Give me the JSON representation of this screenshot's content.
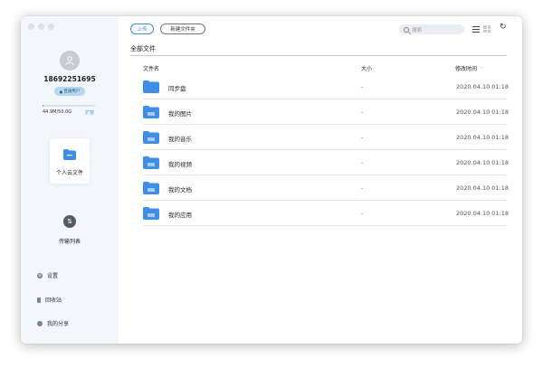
{
  "sidebar": {
    "username": "18692251695",
    "badge": "普通用户",
    "storage_text": "44.9M/50.0G",
    "storage_used_fraction": 0.02,
    "expand_label": "扩容",
    "nav": {
      "personal_cloud": "个人云文件",
      "transfer": "传输列表"
    },
    "links": {
      "settings": "设置",
      "trash": "回收站",
      "share": "我的分享"
    }
  },
  "toolbar": {
    "upload": "上传",
    "new_folder": "新建文件夹",
    "search_placeholder": "搜索",
    "refresh_glyph": "↻"
  },
  "breadcrumb": "全部文件",
  "table": {
    "columns": {
      "name": "文件名",
      "size": "大小",
      "modified": "修改时间"
    },
    "rows": [
      {
        "name": "同步盘",
        "size": "-",
        "modified": "2020.04.10 01:18",
        "icon": "sync-folder-icon"
      },
      {
        "name": "我的图片",
        "size": "-",
        "modified": "2020.04.10 01:18",
        "icon": "folder-icon"
      },
      {
        "name": "我的音乐",
        "size": "-",
        "modified": "2020.04.10 01:18",
        "icon": "folder-icon"
      },
      {
        "name": "我的视频",
        "size": "-",
        "modified": "2020.04.10 01:18",
        "icon": "folder-icon"
      },
      {
        "name": "我的文档",
        "size": "-",
        "modified": "2020.04.10 01:18",
        "icon": "folder-icon"
      },
      {
        "name": "我的应用",
        "size": "-",
        "modified": "2020.04.10 01:18",
        "icon": "folder-icon"
      }
    ]
  },
  "colors": {
    "accent": "#3a8fe0",
    "folder": "#3d8ee4",
    "sidebar_bg": "#f3f7fc"
  }
}
